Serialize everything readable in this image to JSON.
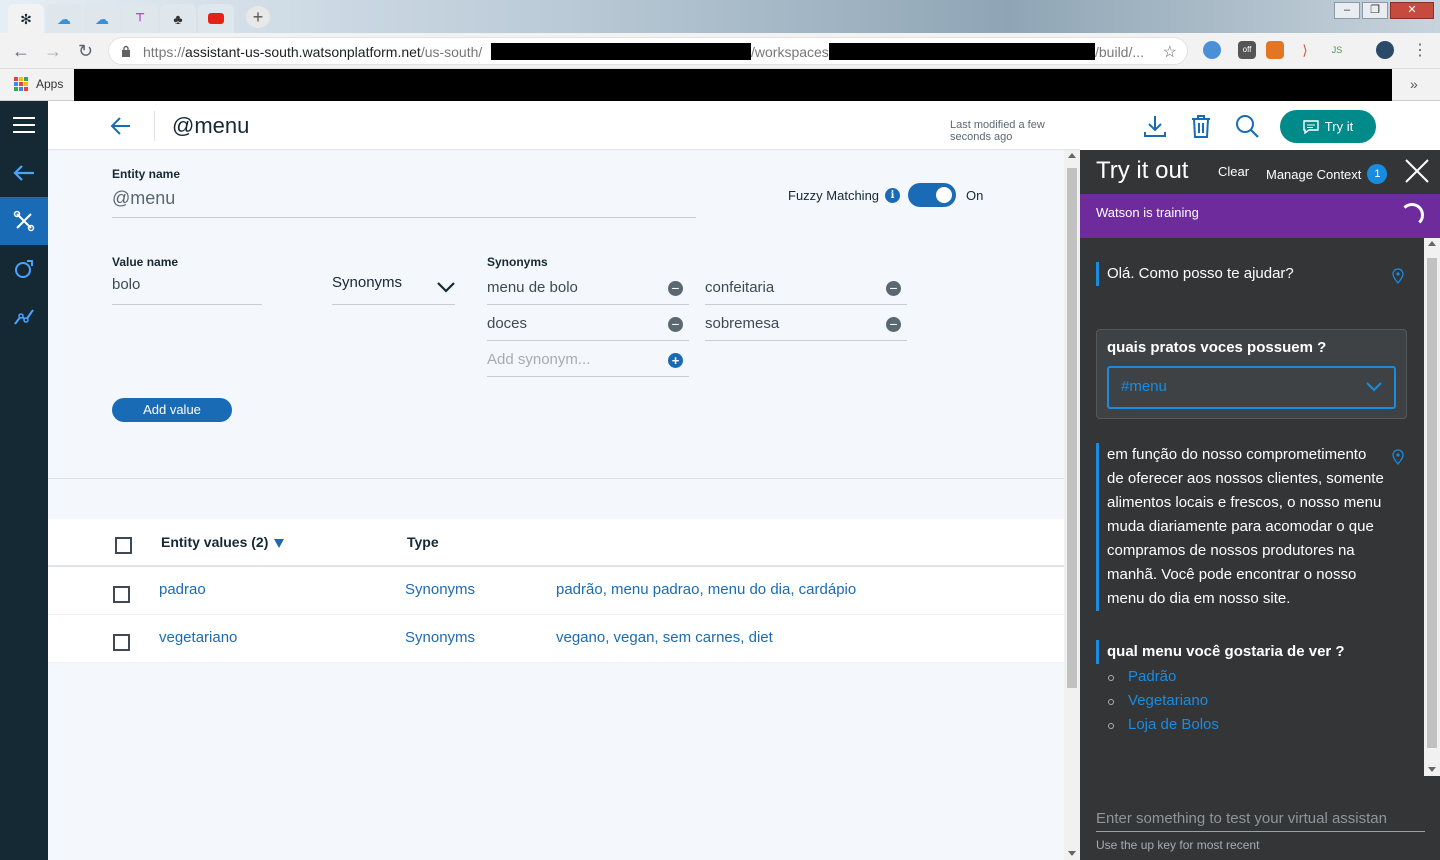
{
  "browser": {
    "tabs": [
      {
        "icon": "bee-icon",
        "active": true
      },
      {
        "icon": "cloud-icon"
      },
      {
        "icon": "cloud-icon"
      },
      {
        "icon": "tf-icon"
      },
      {
        "icon": "chart-icon"
      },
      {
        "icon": "youtube-icon"
      }
    ],
    "url_prefix": "https://",
    "url_host": "assistant-us-south.watsonplatform.net",
    "url_seg1": "/us-south/",
    "url_seg2": "/workspaces/",
    "url_seg3": "/build/...",
    "bookmarks_apps": "Apps",
    "bookmarks_more": "»"
  },
  "header": {
    "title": "@menu",
    "last_modified": "Last modified a few seconds ago",
    "try_it_label": "Try it"
  },
  "entity": {
    "name_label": "Entity name",
    "name_value": "@menu",
    "fuzzy_label": "Fuzzy Matching",
    "fuzzy_state": "On",
    "value_name_label": "Value name",
    "value_name": "bolo",
    "type_value": "Synonyms",
    "synonyms_label": "Synonyms",
    "synonyms": [
      "menu de bolo",
      "confeitaria",
      "doces",
      "sobremesa"
    ],
    "add_synonym_placeholder": "Add synonym...",
    "add_value_label": "Add value"
  },
  "table": {
    "col_values": "Entity values (2)",
    "col_type": "Type",
    "rows": [
      {
        "name": "padrao",
        "type": "Synonyms",
        "values": "padrão, menu padrao, menu do dia, cardápio"
      },
      {
        "name": "vegetariano",
        "type": "Synonyms",
        "values": "vegano, vegan, sem carnes, diet"
      }
    ]
  },
  "panel": {
    "title": "Try it out",
    "clear": "Clear",
    "manage_context": "Manage Context",
    "context_count": "1",
    "training": "Watson is training",
    "greeting": "Olá. Como posso te ajudar?",
    "user_question": "quais pratos voces possuem ?",
    "intent": "#menu",
    "bot_reply": "em função do nosso comprometimento de oferecer aos nossos clientes, somente alimentos locais e frescos, o nosso menu muda diariamente para acomodar o que compramos de nossos produtores na manhã. Você pode encontrar o nosso menu do dia em nosso site.",
    "bot_question": "qual menu você gostaria de ver ?",
    "options": [
      "Padrão",
      "Vegetariano",
      "Loja de Bolos"
    ],
    "input_placeholder": "Enter something to test your virtual assistan",
    "input_hint": "Use the up key for most recent"
  },
  "colors": {
    "accent": "#1a6bb5",
    "nav_bg": "#152935",
    "try_it": "#008a8a",
    "training_bg": "#6e2b9c",
    "panel_bg": "#333537"
  }
}
